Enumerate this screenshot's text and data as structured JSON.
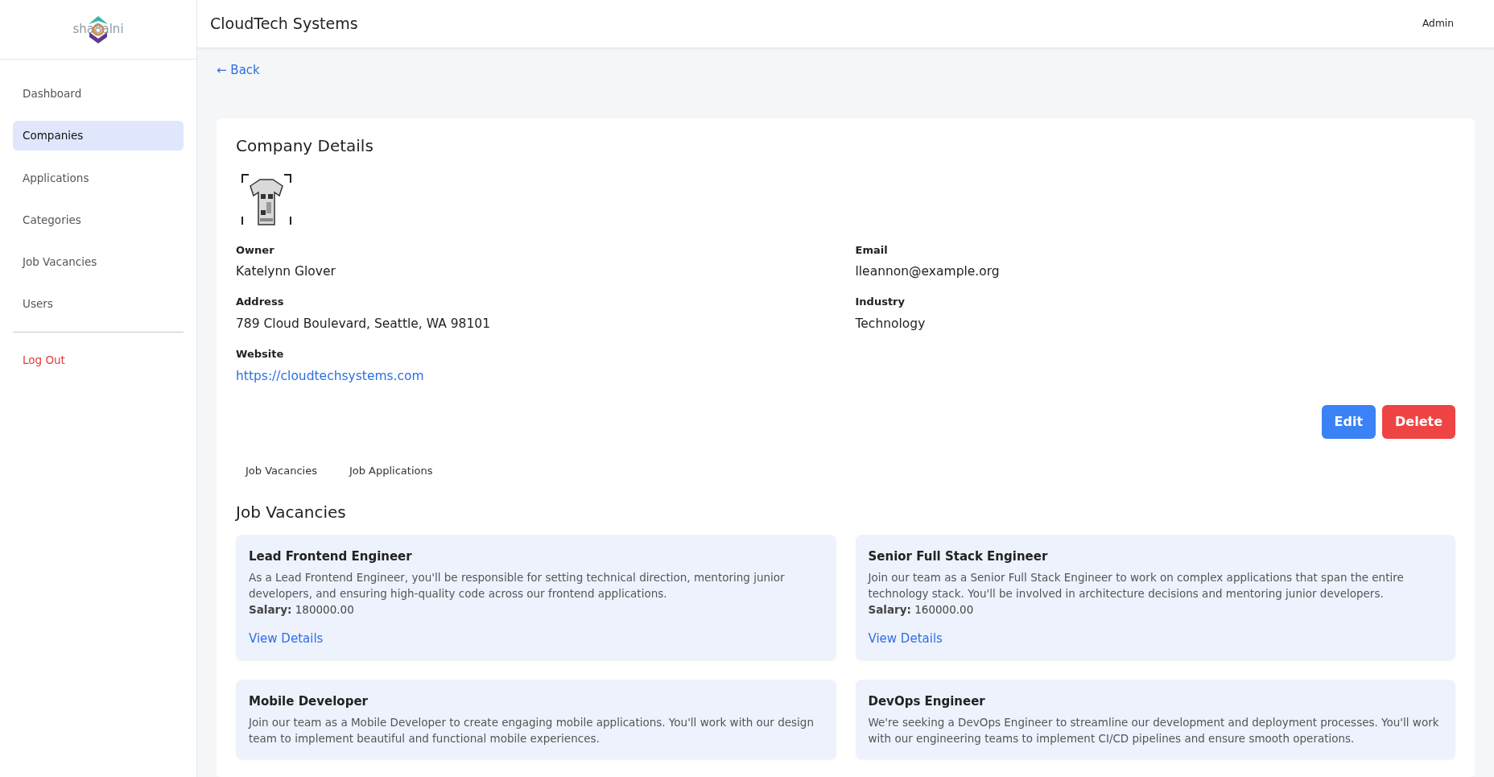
{
  "logo": {
    "text": "sha8alni"
  },
  "sidebar": {
    "items": [
      {
        "label": "Dashboard",
        "selected": false
      },
      {
        "label": "Companies",
        "selected": true
      },
      {
        "label": "Applications",
        "selected": false
      },
      {
        "label": "Categories",
        "selected": false
      },
      {
        "label": "Job Vacancies",
        "selected": false
      },
      {
        "label": "Users",
        "selected": false
      }
    ],
    "logout": "Log Out"
  },
  "header": {
    "title": "CloudTech Systems",
    "user": "Admin"
  },
  "back": "← Back",
  "details": {
    "title": "Company Details",
    "fields": [
      {
        "label": "Owner",
        "value": "Katelynn Glover",
        "kind": "text"
      },
      {
        "label": "Email",
        "value": "lleannon@example.org",
        "kind": "text"
      },
      {
        "label": "Address",
        "value": "789 Cloud Boulevard, Seattle, WA 98101",
        "kind": "text"
      },
      {
        "label": "Industry",
        "value": "Technology",
        "kind": "text"
      },
      {
        "label": "Website",
        "value": "https://cloudtechsystems.com",
        "kind": "link"
      }
    ],
    "buttons": [
      {
        "label": "Edit",
        "kind": "edit"
      },
      {
        "label": "Delete",
        "kind": "delete"
      }
    ]
  },
  "tabs": [
    {
      "label": "Job Vacancies"
    },
    {
      "label": "Job Applications"
    }
  ],
  "vacancies": {
    "title": "Job Vacancies",
    "items": [
      {
        "title": "Lead Frontend Engineer",
        "description": "As a Lead Frontend Engineer, you'll be responsible for setting technical direction, mentoring junior developers, and ensuring high-quality code across our frontend applications.",
        "salary": "**Salary:** 180000.00",
        "link": "View Details"
      },
      {
        "title": "Senior Full Stack Engineer",
        "description": "Join our team as a Senior Full Stack Engineer to work on complex applications that span the entire technology stack. You'll be involved in architecture decisions and mentoring junior developers.",
        "salary": "**Salary:** 160000.00",
        "link": "View Details"
      },
      {
        "title": "Mobile Developer",
        "description": "Join our team as a Mobile Developer to create engaging mobile applications. You'll work with our design team to implement beautiful and functional mobile experiences."
      },
      {
        "title": "DevOps Engineer",
        "description": "We're seeking a DevOps Engineer to streamline our development and deployment processes. You'll work with our engineering teams to implement CI/CD pipelines and ensure smooth operations."
      }
    ]
  }
}
